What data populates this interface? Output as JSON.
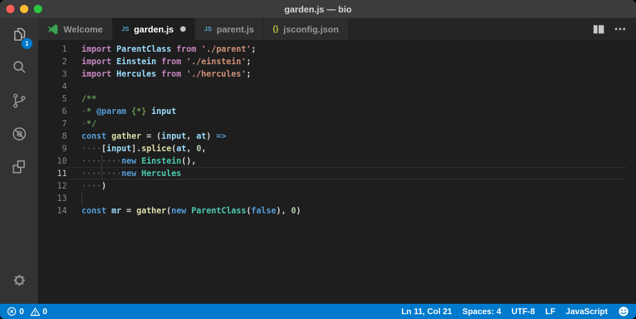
{
  "window": {
    "title": "garden.js — bio"
  },
  "colors": {
    "accent": "#007acc",
    "status_bar_bg": "#007acc",
    "title_bar_bg": "#3c3c3c",
    "activity_bar_bg": "#333333",
    "editor_bg": "#1e1e1e",
    "tab_active_bg": "#1e1e1e",
    "tab_inactive_bg": "#2d2d2d",
    "traffic_lights": [
      "#ff5f57",
      "#febc2e",
      "#28c840"
    ]
  },
  "activity_bar": {
    "items": [
      {
        "name": "explorer",
        "badge": "1"
      },
      {
        "name": "search"
      },
      {
        "name": "source-control"
      },
      {
        "name": "debug"
      },
      {
        "name": "extensions"
      }
    ],
    "bottom": [
      {
        "name": "settings"
      }
    ]
  },
  "tab_bar": {
    "tabs": [
      {
        "label": "Welcome",
        "icon": "vscode-logo-icon",
        "active": false,
        "modified": false
      },
      {
        "label": "garden.js",
        "icon": "js-file-icon",
        "icon_text": "JS",
        "active": true,
        "modified": true
      },
      {
        "label": "parent.js",
        "icon": "js-file-icon",
        "icon_text": "JS",
        "active": false,
        "modified": false
      },
      {
        "label": "jsconfig.json",
        "icon": "json-file-icon",
        "icon_text": "{}",
        "active": false,
        "modified": false
      }
    ],
    "actions": [
      {
        "name": "split-editor"
      },
      {
        "name": "more-actions"
      }
    ]
  },
  "editor": {
    "language": "javascript",
    "active_line": 11,
    "lines": [
      {
        "n": 1,
        "tokens": [
          [
            "kw2",
            "import "
          ],
          [
            "var",
            "ParentClass "
          ],
          [
            "kw2",
            "from "
          ],
          [
            "str",
            "'./parent'"
          ],
          [
            "pun",
            ";"
          ]
        ]
      },
      {
        "n": 2,
        "tokens": [
          [
            "kw2",
            "import "
          ],
          [
            "var",
            "Einstein "
          ],
          [
            "kw2",
            "from "
          ],
          [
            "str",
            "'./einstein'"
          ],
          [
            "pun",
            ";"
          ]
        ]
      },
      {
        "n": 3,
        "tokens": [
          [
            "kw2",
            "import "
          ],
          [
            "var",
            "Hercules "
          ],
          [
            "kw2",
            "from "
          ],
          [
            "str",
            "'./hercules'"
          ],
          [
            "pun",
            ";"
          ]
        ]
      },
      {
        "n": 4,
        "tokens": []
      },
      {
        "n": 5,
        "tokens": [
          [
            "cmt",
            "/**"
          ]
        ]
      },
      {
        "n": 6,
        "tokens": [
          [
            "ws",
            "·"
          ],
          [
            "cmt",
            "* "
          ],
          [
            "kw",
            "@param "
          ],
          [
            "cmt",
            "{*} "
          ],
          [
            "var",
            "input"
          ]
        ]
      },
      {
        "n": 7,
        "tokens": [
          [
            "ws",
            "·"
          ],
          [
            "cmt",
            "*/"
          ]
        ]
      },
      {
        "n": 8,
        "tokens": [
          [
            "kw",
            "const "
          ],
          [
            "fn",
            "gather "
          ],
          [
            "pun",
            "= ("
          ],
          [
            "var",
            "input"
          ],
          [
            "pun",
            ", "
          ],
          [
            "var",
            "at"
          ],
          [
            "pun",
            ") "
          ],
          [
            "kw",
            "=>"
          ]
        ]
      },
      {
        "n": 9,
        "tokens": [
          [
            "ws",
            "····"
          ],
          [
            "pun",
            "["
          ],
          [
            "var",
            "input"
          ],
          [
            "pun",
            "]."
          ],
          [
            "fn",
            "splice"
          ],
          [
            "pun",
            "("
          ],
          [
            "var",
            "at"
          ],
          [
            "pun",
            ", "
          ],
          [
            "num",
            "0"
          ],
          [
            "pun",
            ","
          ]
        ]
      },
      {
        "n": 10,
        "tokens": [
          [
            "ws",
            "····"
          ],
          [
            "guide",
            ""
          ],
          [
            "ws",
            "····"
          ],
          [
            "kw",
            "new "
          ],
          [
            "type",
            "Einstein"
          ],
          [
            "pun",
            "(),"
          ]
        ]
      },
      {
        "n": 11,
        "tokens": [
          [
            "ws",
            "····"
          ],
          [
            "guide",
            ""
          ],
          [
            "ws",
            "····"
          ],
          [
            "kw",
            "new "
          ],
          [
            "type",
            "Hercules"
          ]
        ]
      },
      {
        "n": 12,
        "tokens": [
          [
            "ws",
            "····"
          ],
          [
            "pun",
            ")"
          ]
        ]
      },
      {
        "n": 13,
        "tokens": [
          [
            "guide",
            ""
          ]
        ]
      },
      {
        "n": 14,
        "tokens": [
          [
            "kw",
            "const "
          ],
          [
            "var",
            "mr "
          ],
          [
            "pun",
            "= "
          ],
          [
            "fn",
            "gather"
          ],
          [
            "pun",
            "("
          ],
          [
            "kw",
            "new "
          ],
          [
            "type",
            "ParentClass"
          ],
          [
            "pun",
            "("
          ],
          [
            "kw",
            "false"
          ],
          [
            "pun",
            "), "
          ],
          [
            "num",
            "0"
          ],
          [
            "pun",
            ")"
          ]
        ]
      }
    ]
  },
  "status_bar": {
    "left": [
      {
        "name": "errors",
        "icon": "error-icon",
        "value": "0"
      },
      {
        "name": "warnings",
        "icon": "warning-icon",
        "value": "0"
      }
    ],
    "right": [
      {
        "name": "cursor-position",
        "label": "Ln 11, Col 21"
      },
      {
        "name": "indentation",
        "label": "Spaces: 4"
      },
      {
        "name": "encoding",
        "label": "UTF-8"
      },
      {
        "name": "eol",
        "label": "LF"
      },
      {
        "name": "language-mode",
        "label": "JavaScript"
      }
    ],
    "feedback": {
      "name": "feedback-smiley"
    }
  }
}
